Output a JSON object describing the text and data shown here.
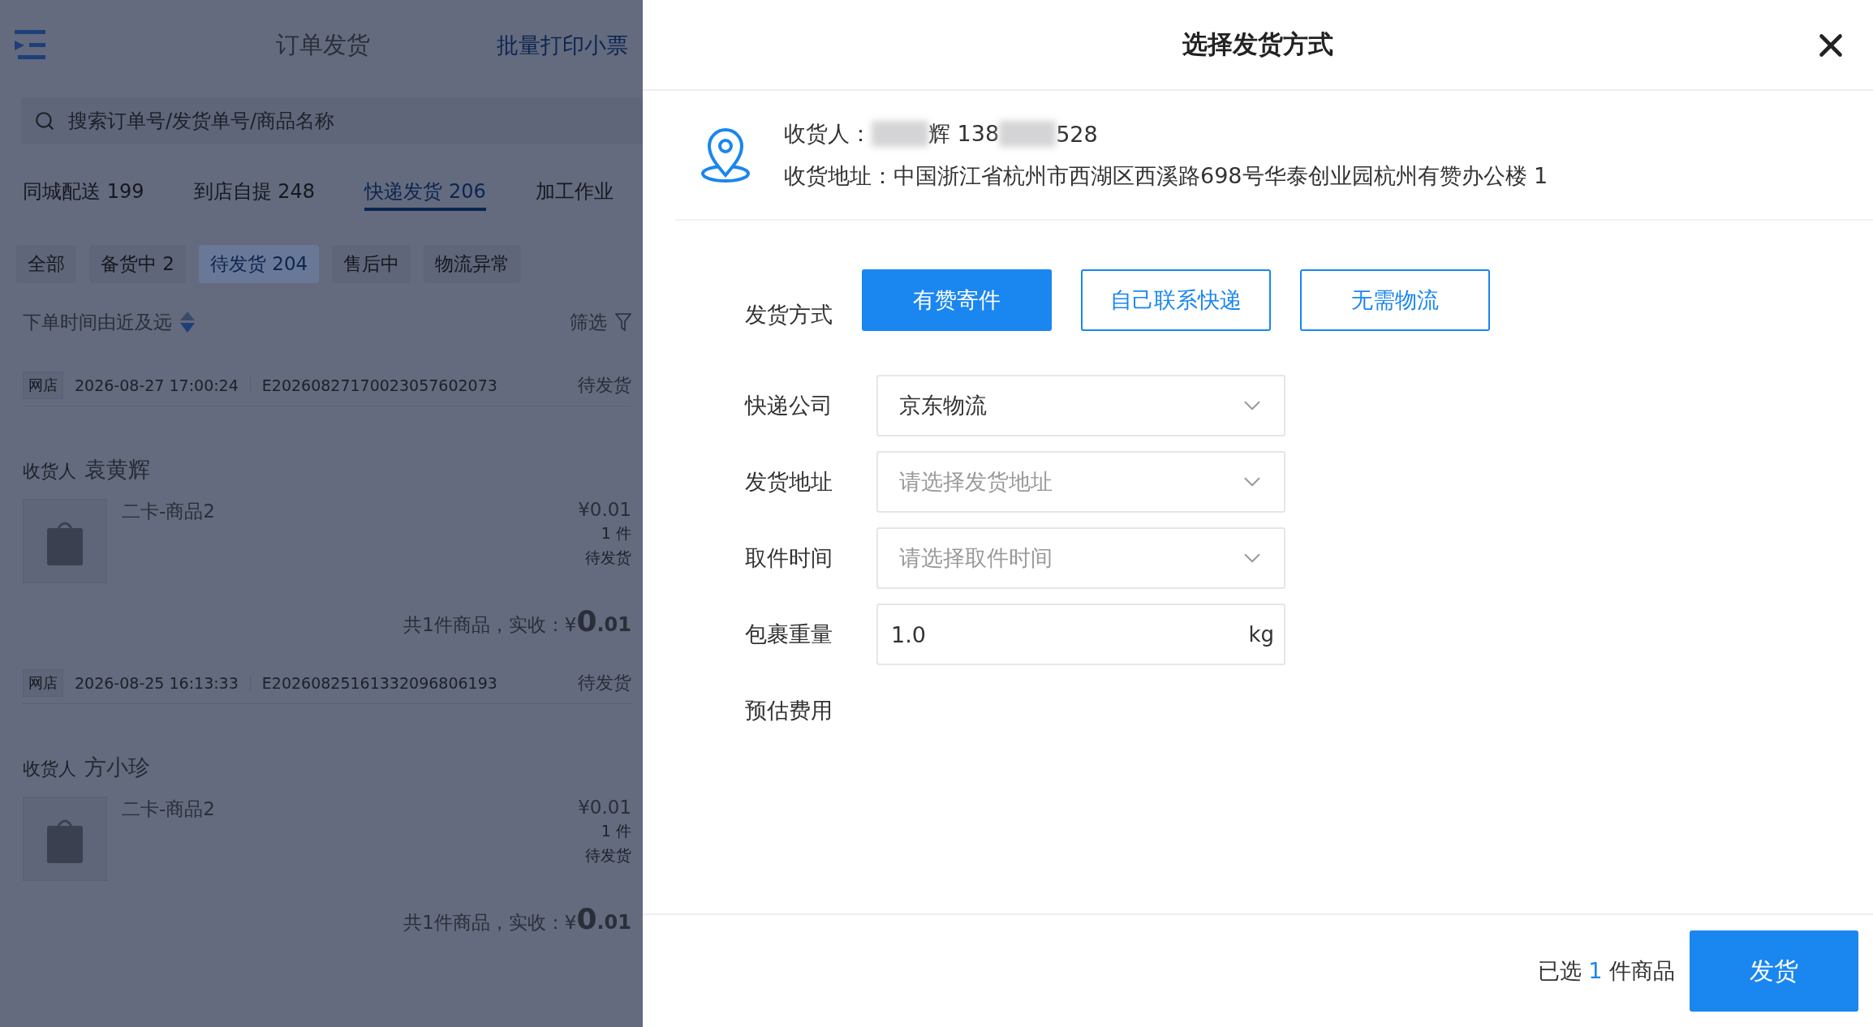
{
  "order_list": {
    "title": "订单发货",
    "action": "批量打印小票",
    "search": {
      "placeholder": "搜索订单号/发货单号/商品名称"
    },
    "tabs": [
      {
        "label": "同城配送 199",
        "selected": false
      },
      {
        "label": "到店自提 248",
        "selected": false
      },
      {
        "label": "快递发货 206",
        "selected": true
      },
      {
        "label": "加工作业",
        "selected": false
      }
    ],
    "filters": [
      {
        "label": "全部",
        "selected": false
      },
      {
        "label": "备货中 2",
        "selected": false
      },
      {
        "label": "待发货 204",
        "selected": true
      },
      {
        "label": "售后中",
        "selected": false
      },
      {
        "label": "物流异常",
        "selected": false
      }
    ],
    "sort": "下单时间由近及远",
    "filter_button": "筛选",
    "orders": [
      {
        "source": "网店",
        "time": "2026-08-27 17:00:24",
        "order_no": "E20260827170023057602073",
        "status": "待发货",
        "consignee_label": "收货人",
        "consignee": "袁黄辉",
        "items": [
          {
            "name": "二卡-商品2",
            "price": "¥0.01",
            "quantity": "1 件",
            "status": "待发货"
          }
        ],
        "summary": "共1件商品，实收：",
        "currency": "¥",
        "amount_int": "0",
        "amount_dec": ".01"
      },
      {
        "source": "网店",
        "time": "2026-08-25 16:13:33",
        "order_no": "E20260825161332096806193",
        "status": "待发货",
        "consignee_label": "收货人",
        "consignee": "方小珍",
        "items": [
          {
            "name": "二卡-商品2",
            "price": "¥0.01",
            "quantity": "1 件",
            "status": "待发货"
          }
        ],
        "summary": "共1件商品，实收：",
        "currency": "¥",
        "amount_int": "0",
        "amount_dec": ".01"
      }
    ]
  },
  "dialog": {
    "title": "选择发货方式",
    "consignee": {
      "label": "收货人：",
      "parts": [
        {
          "kind": "redacted"
        },
        {
          "kind": "text",
          "text": "辉 138"
        },
        {
          "kind": "redacted"
        },
        {
          "kind": "text",
          "text": "528"
        }
      ]
    },
    "address": {
      "label": "收货地址：",
      "value": "中国浙江省杭州市西湖区西溪路698号华泰创业园杭州有赞办公楼 1"
    },
    "method": {
      "label": "发货方式",
      "options": [
        {
          "label": "有赞寄件",
          "selected": true
        },
        {
          "label": "自己联系快递",
          "selected": false
        },
        {
          "label": "无需物流",
          "selected": false
        }
      ]
    },
    "fields": [
      {
        "kind": "select",
        "label": "快递公司",
        "value": "京东物流"
      },
      {
        "kind": "select",
        "label": "发货地址",
        "placeholder": "请选择发货地址"
      },
      {
        "kind": "select",
        "label": "取件时间",
        "placeholder": "请选择取件时间"
      },
      {
        "kind": "input",
        "label": "包裹重量",
        "value": "1.0",
        "unit": "kg"
      },
      {
        "kind": "text",
        "label": "预估费用"
      }
    ],
    "footer": {
      "prefix": "已选",
      "count": "1",
      "suffix": "件商品",
      "submit": "发货"
    }
  }
}
